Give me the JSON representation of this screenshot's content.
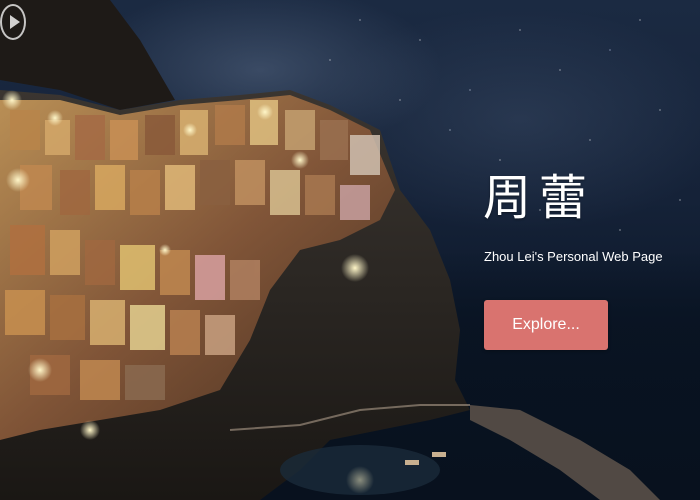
{
  "hero": {
    "title": "周蕾",
    "subtitle": "Zhou Lei's Personal Web Page",
    "explore_label": "Explore...",
    "play_icon": "play-circle-icon",
    "background_image": "night-coastal-village-cliff",
    "accent_color": "#d9736f"
  }
}
